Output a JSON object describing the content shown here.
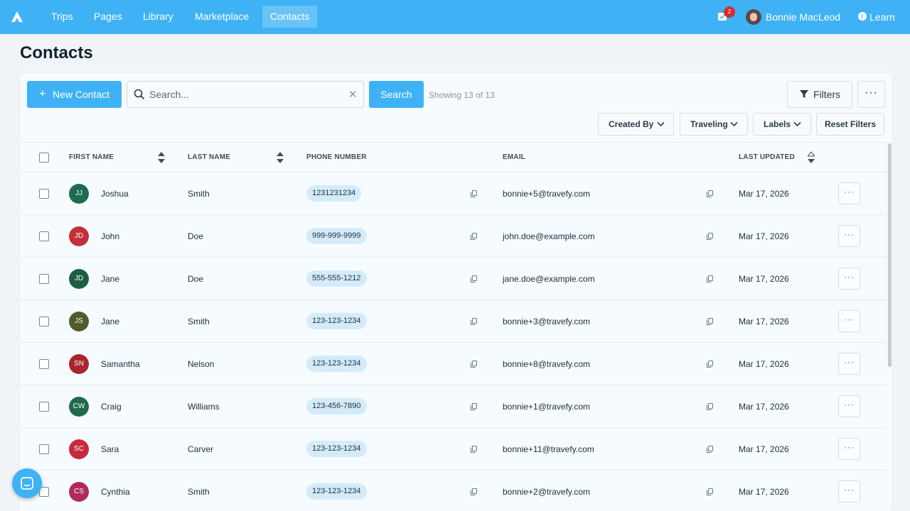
{
  "nav": {
    "items": [
      {
        "label": "Trips",
        "active": false
      },
      {
        "label": "Pages",
        "active": false
      },
      {
        "label": "Library",
        "active": false
      },
      {
        "label": "Marketplace",
        "active": false
      },
      {
        "label": "Contacts",
        "active": true
      }
    ],
    "notification_count": "2",
    "user_name": "Bonnie MacLeod",
    "learn_label": "Learn",
    "accent_color": "#3fb2f5"
  },
  "page": {
    "title": "Contacts"
  },
  "toolbar": {
    "new_contact_label": "New Contact",
    "search_placeholder": "Search...",
    "search_value": "",
    "search_button_label": "Search",
    "showing_text": "Showing 13 of 13",
    "filters_label": "Filters",
    "more_label": "···"
  },
  "filters": {
    "created_by_label": "Created By",
    "traveling_label": "Traveling",
    "labels_label": "Labels",
    "reset_label": "Reset Filters"
  },
  "table": {
    "columns": {
      "first_name": "FIRST NAME",
      "last_name": "LAST NAME",
      "phone": "PHONE NUMBER",
      "email": "EMAIL",
      "last_updated": "LAST UPDATED"
    },
    "rows": [
      {
        "initials": "JJ",
        "avatar_color": "#1e6b4f",
        "first": "Joshua",
        "last": "Smith",
        "phone": "1231231234",
        "email": "bonnie+5@travefy.com",
        "updated": "Mar 17, 2026"
      },
      {
        "initials": "JD",
        "avatar_color": "#c4303a",
        "first": "John",
        "last": "Doe",
        "phone": "999-999-9999",
        "email": "john.doe@example.com",
        "updated": "Mar 17, 2026"
      },
      {
        "initials": "JD",
        "avatar_color": "#1b5e45",
        "first": "Jane",
        "last": "Doe",
        "phone": "555-555-1212",
        "email": "jane.doe@example.com",
        "updated": "Mar 17, 2026"
      },
      {
        "initials": "JS",
        "avatar_color": "#545a2c",
        "first": "Jane",
        "last": "Smith",
        "phone": "123-123-1234",
        "email": "bonnie+3@travefy.com",
        "updated": "Mar 17, 2026"
      },
      {
        "initials": "SN",
        "avatar_color": "#a8262c",
        "first": "Samantha",
        "last": "Nelson",
        "phone": "123-123-1234",
        "email": "bonnie+8@travefy.com",
        "updated": "Mar 17, 2026"
      },
      {
        "initials": "CW",
        "avatar_color": "#206a4c",
        "first": "Craig",
        "last": "Williams",
        "phone": "123-456-7890",
        "email": "bonnie+1@travefy.com",
        "updated": "Mar 17, 2026"
      },
      {
        "initials": "SC",
        "avatar_color": "#c72a3c",
        "first": "Sara",
        "last": "Carver",
        "phone": "123-123-1234",
        "email": "bonnie+11@travefy.com",
        "updated": "Mar 17, 2026"
      },
      {
        "initials": "CS",
        "avatar_color": "#b02a5a",
        "first": "Cynthia",
        "last": "Smith",
        "phone": "123-123-1234",
        "email": "bonnie+2@travefy.com",
        "updated": "Mar 17, 2026"
      }
    ]
  }
}
